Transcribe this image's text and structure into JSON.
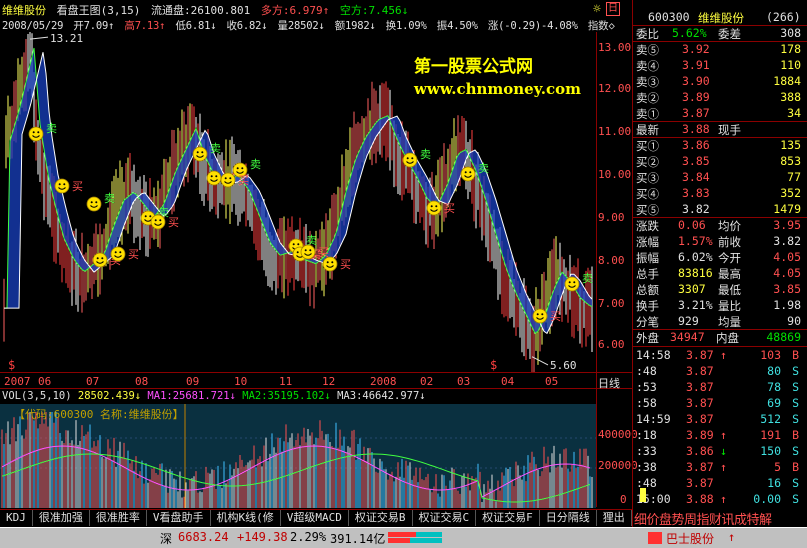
{
  "header": {
    "stock_name": "维维股份",
    "main_chart_label": "看盘王图(3,15)",
    "float_label": "流通盘:26100.801",
    "long_label": "多方:6.979↑",
    "short_label": "空方:7.456↓",
    "date": "2008/05/29",
    "open": "开7.09↑",
    "high": "高7.13↑",
    "low": "低6.81↓",
    "close": "收6.82↓",
    "volume": "量28502↓",
    "amount": "额1982↓",
    "turnover": "换1.09%",
    "amplitude": "振4.50%",
    "change": "涨(-0.29)-4.08%",
    "index_label": "指数◇"
  },
  "chart": {
    "max_label": "13.21",
    "min_label": "5.60",
    "y_ticks": [
      "13.00",
      "12.00",
      "11.00",
      "10.00",
      "9.00",
      "8.00",
      "7.00",
      "6.00"
    ],
    "x_ticks": [
      "2007",
      "06",
      "07",
      "08",
      "09",
      "10",
      "11",
      "12",
      "2008",
      "02",
      "03",
      "04",
      "05"
    ],
    "period_label": "日线",
    "watermark_title": "第一股票公式网",
    "watermark_url": "www.chnmoney.com",
    "sell_label": "卖",
    "buy_label": "买",
    "dollar": "$"
  },
  "volume_panel": {
    "label": "VOL(3,5,10)",
    "vol": "28502.439↓",
    "ma1": "MA1:25681.721↓",
    "ma2": "MA2:35195.102↓",
    "ma3": "MA3:46642.977↓",
    "info": "【代码:600300 名称:维维股份】",
    "y_ticks": [
      "400000",
      "200000",
      "0"
    ]
  },
  "tabs": [
    "KDJ",
    "很准加强",
    "很准胜率",
    "V看盘助手",
    "机构K线(修",
    "V超级MACD",
    "权证交易B",
    "权证交易C",
    "权证交易F",
    "日分隔线",
    "狸出"
  ],
  "quote": {
    "code": "600300",
    "name": "维维股份",
    "count": "(266)",
    "wei_bi": {
      "label": "委比",
      "value": "5.62%",
      "label2": "委差",
      "value2": "308"
    },
    "sells": [
      {
        "label": "卖⑤",
        "price": "3.92",
        "vol": "178"
      },
      {
        "label": "卖④",
        "price": "3.91",
        "vol": "110"
      },
      {
        "label": "卖③",
        "price": "3.90",
        "vol": "1884"
      },
      {
        "label": "卖②",
        "price": "3.89",
        "vol": "388"
      },
      {
        "label": "卖①",
        "price": "3.87",
        "vol": "34"
      }
    ],
    "latest": {
      "label": "最新",
      "price": "3.88",
      "label2": "现手",
      "value2": ""
    },
    "buys": [
      {
        "label": "买①",
        "price": "3.86",
        "vol": "135"
      },
      {
        "label": "买②",
        "price": "3.85",
        "vol": "853"
      },
      {
        "label": "买③",
        "price": "3.84",
        "vol": "77"
      },
      {
        "label": "买④",
        "price": "3.83",
        "vol": "352"
      },
      {
        "label": "买⑤",
        "price": "3.82",
        "vol": "1479"
      }
    ],
    "stats": [
      {
        "l1": "涨跌",
        "v1": "0.06",
        "l2": "均价",
        "v2": "3.95"
      },
      {
        "l1": "涨幅",
        "v1": "1.57%",
        "l2": "前收",
        "v2": "3.82"
      },
      {
        "l1": "振幅",
        "v1": "6.02%",
        "l2": "今开",
        "v2": "4.05"
      },
      {
        "l1": "总手",
        "v1": "83816",
        "l2": "最高",
        "v2": "4.05"
      },
      {
        "l1": "总额",
        "v1": "3307",
        "l2": "最低",
        "v2": "3.85"
      },
      {
        "l1": "换手",
        "v1": "3.21%",
        "l2": "量比",
        "v2": "1.98"
      },
      {
        "l1": "分笔",
        "v1": "929",
        "l2": "均量",
        "v2": "90"
      }
    ],
    "outer": {
      "label": "外盘",
      "value": "34947",
      "label2": "内盘",
      "value2": "48869"
    },
    "ticks": [
      {
        "time": "14:58",
        "price": "3.87",
        "arrow": "↑",
        "vol": "103",
        "side": "B"
      },
      {
        "time": ":48",
        "price": "3.87",
        "arrow": "",
        "vol": "80",
        "side": "S"
      },
      {
        "time": ":53",
        "price": "3.87",
        "arrow": "",
        "vol": "78",
        "side": "S"
      },
      {
        "time": ":58",
        "price": "3.87",
        "arrow": "",
        "vol": "69",
        "side": "S"
      },
      {
        "time": "14:59",
        "price": "3.87",
        "arrow": "",
        "vol": "512",
        "side": "S"
      },
      {
        "time": ":18",
        "price": "3.89",
        "arrow": "↑",
        "vol": "191",
        "side": "B"
      },
      {
        "time": ":33",
        "price": "3.86",
        "arrow": "↓",
        "vol": "150",
        "side": "S"
      },
      {
        "time": ":38",
        "price": "3.87",
        "arrow": "↑",
        "vol": "5",
        "side": "B"
      },
      {
        "time": ":48",
        "price": "3.87",
        "arrow": "",
        "vol": "16",
        "side": "S"
      },
      {
        "time": "15:00",
        "price": "3.88",
        "arrow": "↑",
        "vol": "0.00",
        "side": "S"
      }
    ],
    "bottom_tabs": "细价盘势周指财讯成特解"
  },
  "status": {
    "market": "深",
    "index_value": "6683.24",
    "index_change": "+149.38",
    "index_pct": "2.29%",
    "amount": "391.14亿",
    "stock_name": "巴士股份",
    "stock_arrow": "↑"
  }
}
